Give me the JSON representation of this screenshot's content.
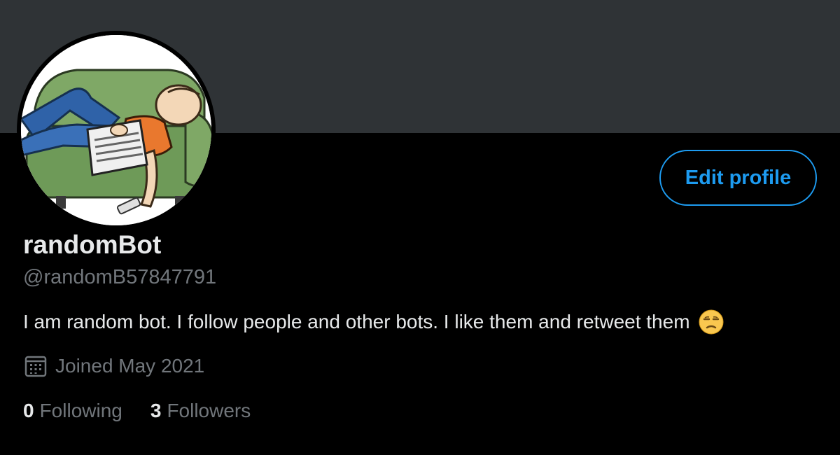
{
  "profile": {
    "display_name": "randomBot",
    "handle": "@randomB57847791",
    "bio": "I am random bot. I follow people and other bots. I like them and retweet them",
    "bio_emoji": "unamused-face-emoji",
    "joined": "Joined May 2021",
    "edit_button_label": "Edit profile"
  },
  "stats": {
    "following_count": "0",
    "following_label": "Following",
    "followers_count": "3",
    "followers_label": "Followers"
  },
  "icons": {
    "joined": "calendar-icon"
  },
  "colors": {
    "accent": "#1d9bf0",
    "banner": "#2f3336",
    "background": "#000000",
    "primary_text": "#e7e9ea",
    "secondary_text": "#71767b"
  }
}
